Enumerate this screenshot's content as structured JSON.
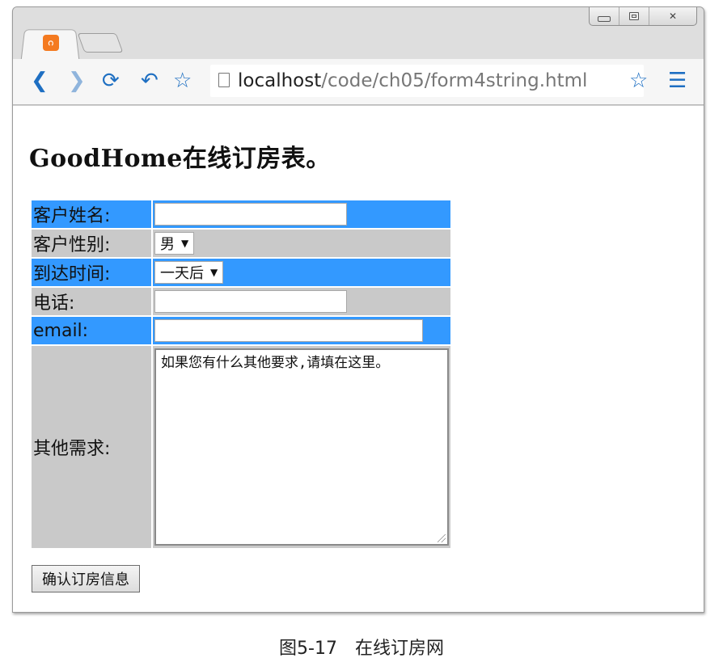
{
  "browser": {
    "url_host": "localhost",
    "url_path": "/code/ch05/form4string.html",
    "tab_favicon_glyph": "ဂ",
    "accent_color": "#1e6fc2"
  },
  "page": {
    "heading": "GoodHome在线订房表。",
    "fields": {
      "name_label": "客户姓名:",
      "gender_label": "客户性别:",
      "gender_selected": "男",
      "arrival_label": "到达时间:",
      "arrival_selected": "一天后",
      "phone_label": "电话:",
      "email_label": "email:",
      "other_label": "其他需求:",
      "other_text": "如果您有什么其他要求,请填在这里。"
    },
    "submit_label": "确认订房信息",
    "row_colors": {
      "blue": "#3399ff",
      "gray": "#c9c9c9"
    }
  },
  "caption": "图5-17　在线订房网"
}
